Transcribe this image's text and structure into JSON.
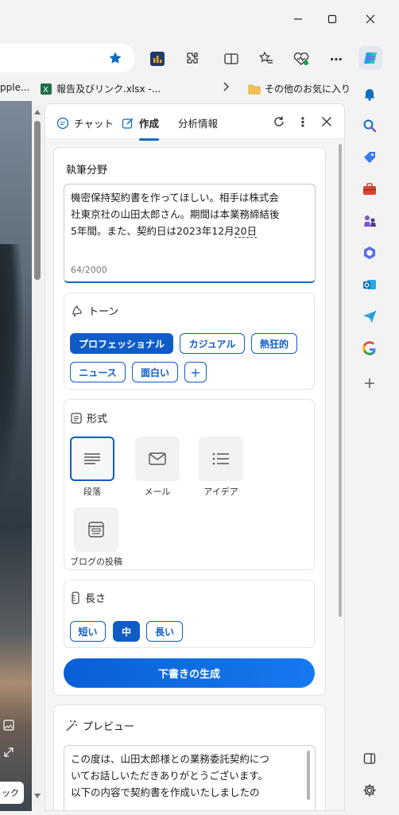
{
  "window": {
    "minimize_label": "—",
    "maximize_label": "☐",
    "close_label": "✕"
  },
  "favorites": [
    {
      "label": "pple..."
    },
    {
      "label": "報告及びリンク.xlsx -..."
    },
    {
      "label": "その他のお気に入り"
    }
  ],
  "panel": {
    "tabs": [
      {
        "label": "チャット"
      },
      {
        "label": "作成"
      },
      {
        "label": "分析情報"
      }
    ],
    "compose": {
      "title": "執筆分野",
      "text_lines": [
        "機密保持契約書を作ってほしい。相手は株式会",
        "社東京社の山田太郎さん。期間は本業務締結後",
        "5年間。また、契約日は2023年12月",
        "20日"
      ],
      "char_count": "64/2000"
    },
    "tone": {
      "title": "トーン",
      "options": [
        "プロフェッショナル",
        "カジュアル",
        "熱狂的",
        "ニュース",
        "面白い",
        "+"
      ],
      "selected": "プロフェッショナル"
    },
    "format": {
      "title": "形式",
      "options": [
        {
          "label": "段落",
          "icon": "paragraph-icon"
        },
        {
          "label": "メール",
          "icon": "mail-icon"
        },
        {
          "label": "アイデア",
          "icon": "list-icon"
        },
        {
          "label": "ブログの投稿",
          "icon": "blog-icon"
        }
      ],
      "selected": "段落"
    },
    "length": {
      "title": "長さ",
      "options": [
        "短い",
        "中",
        "長い"
      ],
      "selected": "中"
    },
    "generate_label": "下書きの生成",
    "preview": {
      "title": "プレビュー",
      "lines": [
        "この度は、山田太郎様との業務委託契約につ",
        "いてお話しいただきありがとうございます。",
        "以下の内容で契約書を作成いたしましたの"
      ]
    }
  },
  "overlay_text": "ック",
  "colors": {
    "accent": "#0f5cc7",
    "generate_button": "#0a5fd6"
  }
}
